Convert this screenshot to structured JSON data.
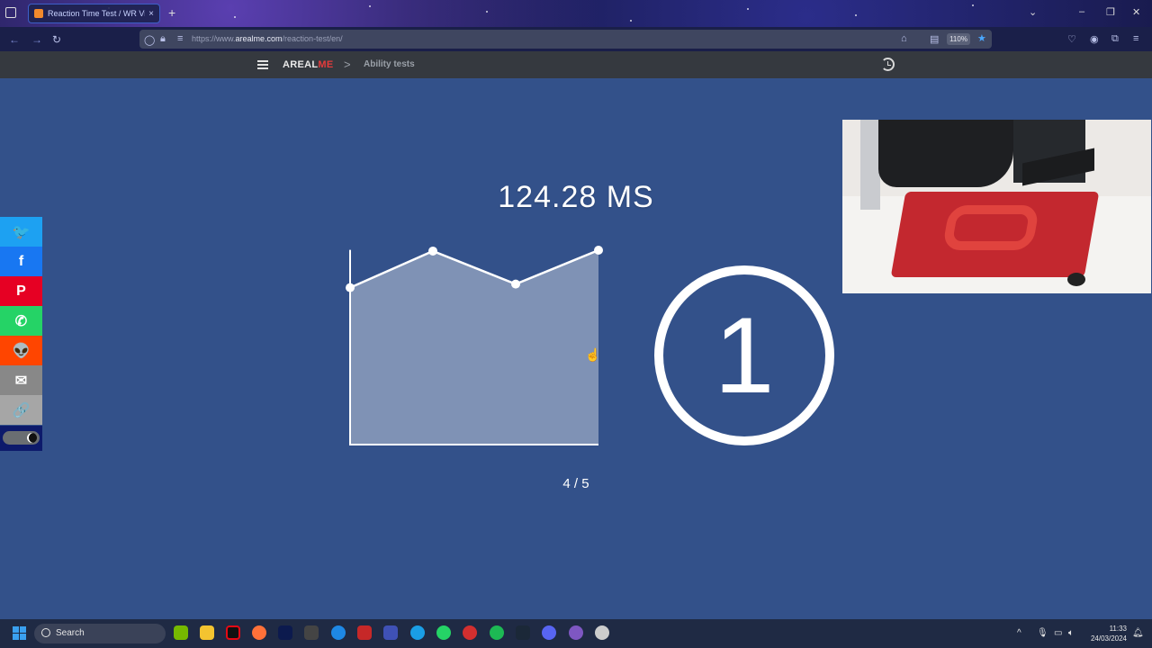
{
  "browser": {
    "tab_title": "Reaction Time Test / WR Video",
    "url_prefix": "https://www.",
    "url_domain": "arealme.com",
    "url_path": "/reaction-test/en/",
    "zoom": "110%",
    "new_tab": "+",
    "tab_close": "×"
  },
  "site": {
    "brand_prefix": "AREAL",
    "brand_suffix": "ME",
    "breadcrumb_sep": ">",
    "breadcrumb": "Ability tests"
  },
  "test": {
    "result": "124.28 MS",
    "countdown": "1",
    "progress": "4 / 5"
  },
  "chart_data": {
    "type": "area",
    "attempts": [
      1,
      2,
      3,
      4
    ],
    "values": [
      176,
      217,
      180,
      218
    ],
    "fill_color": "#7f92b5",
    "line_color": "#ffffff"
  },
  "share": {
    "buttons": [
      {
        "name": "twitter",
        "glyph": "🐦",
        "color": "#1da1f2"
      },
      {
        "name": "facebook",
        "glyph": "f",
        "color": "#1877f2"
      },
      {
        "name": "pinterest",
        "glyph": "P",
        "color": "#e60023"
      },
      {
        "name": "whatsapp",
        "glyph": "✆",
        "color": "#25d366"
      },
      {
        "name": "reddit",
        "glyph": "👽",
        "color": "#ff4500"
      },
      {
        "name": "email",
        "glyph": "✉",
        "color": "#888888"
      },
      {
        "name": "copy-link",
        "glyph": "🔗",
        "color": "#a6a6a6"
      }
    ]
  },
  "taskbar": {
    "search_label": "Search",
    "time": "11:33",
    "date": "24/03/2024"
  }
}
